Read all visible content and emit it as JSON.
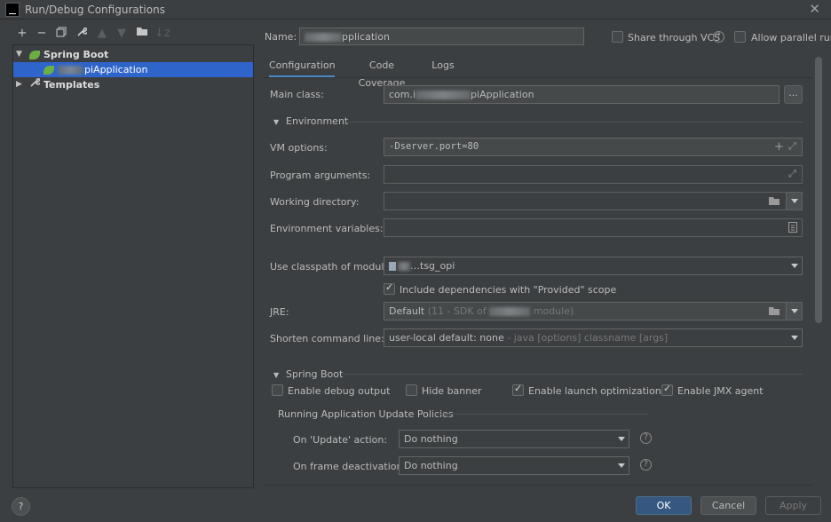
{
  "window": {
    "title": "Run/Debug Configurations",
    "app_icon_glyph": "IJ",
    "close_glyph": "✕"
  },
  "toolbar": {
    "icons": [
      "add-icon",
      "remove-icon",
      "copy-icon",
      "wrench-icon",
      "move-up-icon",
      "move-down-icon",
      "folder-move-icon",
      "sort-icon"
    ]
  },
  "tree": {
    "spring_boot_label": "Spring Boot",
    "selected_item_label": "piApplication",
    "templates_label": "Templates"
  },
  "header": {
    "name_label": "Name:",
    "name_value": "pplication",
    "share_vcs_label": "Share through VCS",
    "allow_parallel_label": "Allow parallel run"
  },
  "tabs": [
    {
      "label": "Configuration",
      "active": true
    },
    {
      "label": "Code Coverage",
      "active": false
    },
    {
      "label": "Logs",
      "active": false
    }
  ],
  "config": {
    "main_class_label": "Main class:",
    "main_class_prefix": "com.i",
    "main_class_suffix": "piApplication",
    "browse_button": "...",
    "environment_label": "Environment",
    "vm_options_label": "VM options:",
    "vm_options_value": "-Dserver.port=80",
    "program_args_label": "Program arguments:",
    "working_dir_label": "Working directory:",
    "env_vars_label": "Environment variables:",
    "classpath_label": "Use classpath of module:",
    "classpath_value": "…tsg_opi",
    "include_deps_label": "Include dependencies with \"Provided\" scope",
    "include_deps_checked": true,
    "jre_label": "JRE:",
    "jre_value_main": "Default",
    "jre_value_hint_prefix": "(11 - SDK of",
    "jre_value_hint_suffix": "module)",
    "shorten_label": "Shorten command line:",
    "shorten_value_main": "user-local default: none",
    "shorten_value_hint": "- java [options] classname [args]"
  },
  "spring_boot": {
    "section_label": "Spring Boot",
    "debug_output_label": "Enable debug output",
    "debug_output_checked": false,
    "hide_banner_label": "Hide banner",
    "hide_banner_checked": false,
    "launch_opt_label": "Enable launch optimization",
    "launch_opt_checked": true,
    "jmx_label": "Enable JMX agent",
    "jmx_checked": true,
    "policies_label": "Running Application Update Policies",
    "on_update_label": "On 'Update' action:",
    "on_update_value": "Do nothing",
    "on_frame_label": "On frame deactivation:",
    "on_frame_value": "Do nothing"
  },
  "footer": {
    "help_glyph": "?",
    "ok_label": "OK",
    "cancel_label": "Cancel",
    "apply_label": "Apply"
  },
  "colors": {
    "background": "#3c3f41",
    "selection": "#2f65ca",
    "ok_button": "#365880",
    "spring_green": "#6cad44"
  }
}
